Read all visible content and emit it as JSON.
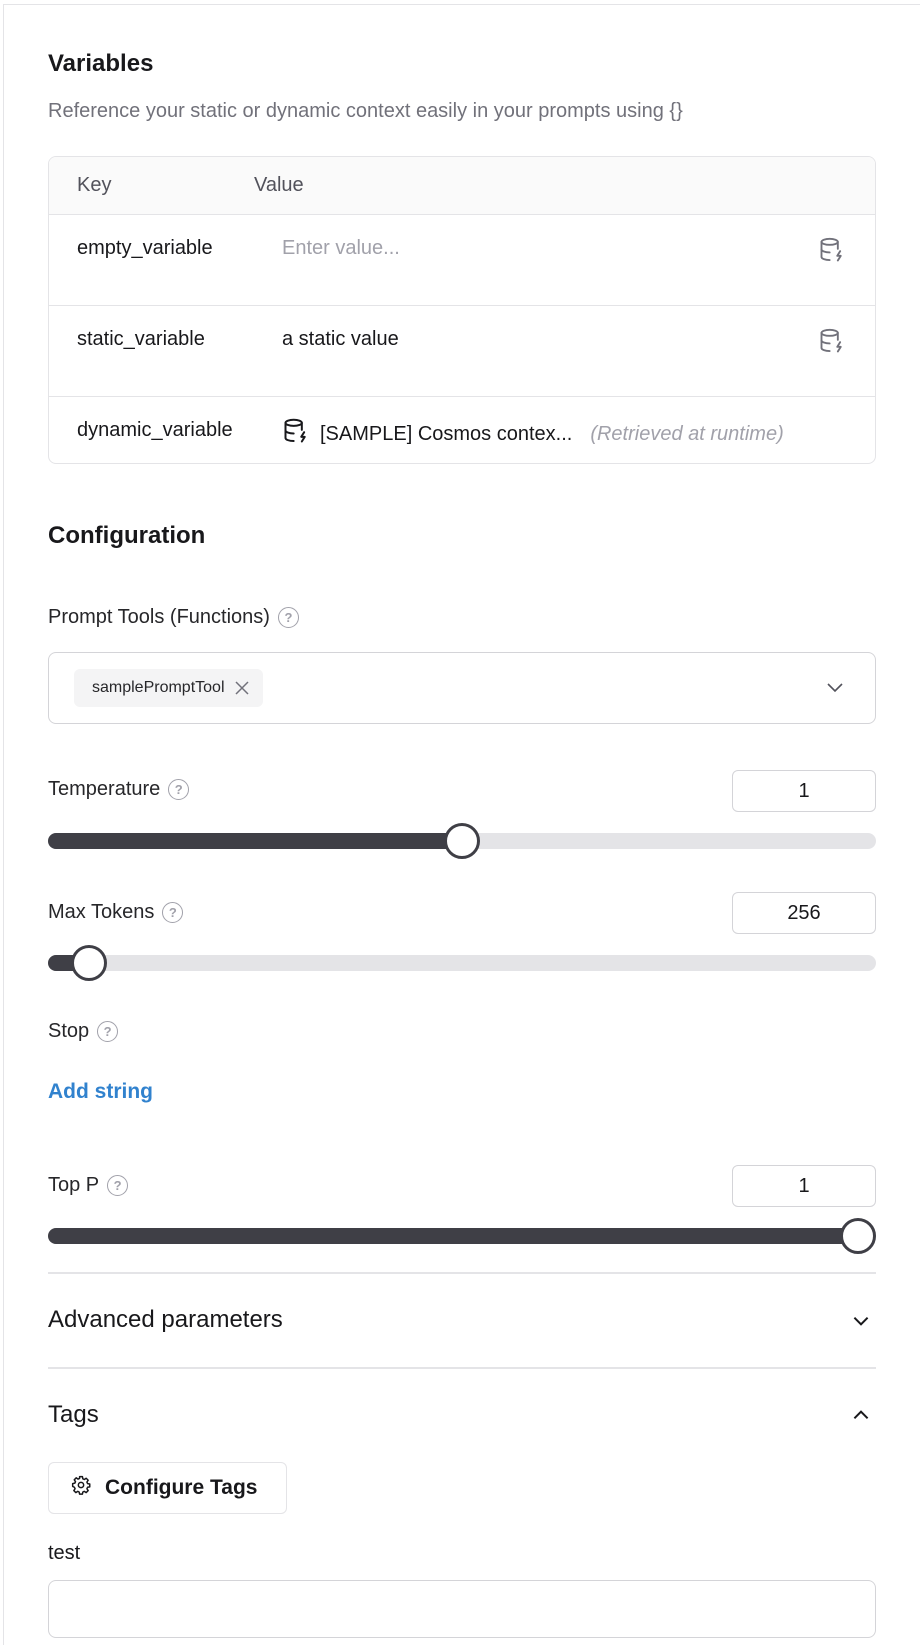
{
  "variables": {
    "title": "Variables",
    "subtitle": "Reference your static or dynamic context easily in your prompts using {}",
    "columns": {
      "key": "Key",
      "value": "Value"
    },
    "rows": [
      {
        "key": "empty_variable",
        "value": "",
        "placeholder": "Enter value...",
        "icon": "database-lightning-icon"
      },
      {
        "key": "static_variable",
        "value": "a static value",
        "icon": "database-lightning-icon"
      },
      {
        "key": "dynamic_variable",
        "value": "[SAMPLE] Cosmos contex...",
        "note": "(Retrieved at runtime)",
        "icon": "database-lightning-icon"
      }
    ]
  },
  "configuration": {
    "title": "Configuration",
    "prompt_tools": {
      "label": "Prompt Tools (Functions)",
      "selected": [
        "samplePromptTool"
      ]
    },
    "temperature": {
      "label": "Temperature",
      "value": "1",
      "min": 0,
      "max": 2,
      "current": 1
    },
    "max_tokens": {
      "label": "Max Tokens",
      "value": "256",
      "fraction": 0.05
    },
    "stop": {
      "label": "Stop",
      "add_label": "Add string"
    },
    "top_p": {
      "label": "Top P",
      "value": "1",
      "min": 0,
      "max": 1,
      "current": 1
    }
  },
  "advanced": {
    "title": "Advanced parameters",
    "expanded": false
  },
  "tags": {
    "title": "Tags",
    "expanded": true,
    "configure_label": "Configure Tags",
    "fields": [
      {
        "label": "test",
        "value": ""
      }
    ]
  },
  "colors": {
    "accent_link": "#3182ce",
    "slider_fill": "#3f3f46",
    "slider_track": "#e4e4e7"
  }
}
